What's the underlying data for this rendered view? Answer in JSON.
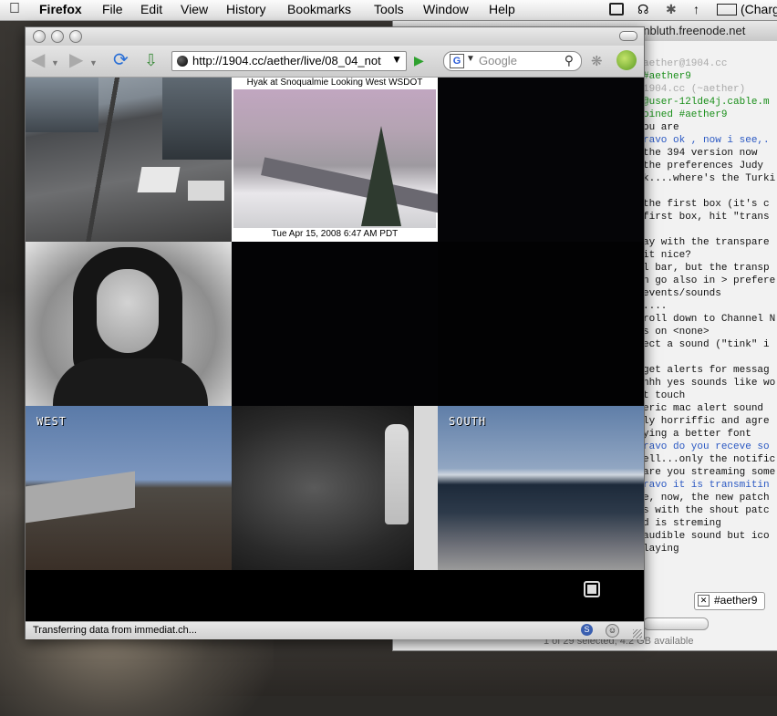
{
  "menubar": {
    "app": "Firefox",
    "items": [
      "File",
      "Edit",
      "View",
      "History",
      "Bookmarks",
      "Tools",
      "Window",
      "Help"
    ],
    "battery_label": "(Charg"
  },
  "irc": {
    "title": "rnbluth.freenode.net",
    "lines": [
      {
        "t": "aether@1904.cc",
        "c": "gray"
      },
      {
        "t": "#aether9",
        "c": "g"
      },
      {
        "t": "1904.cc (~aether)",
        "c": "gray"
      },
      {
        "t": "@user-12lde4j.cable.m",
        "c": "g"
      },
      {
        "t": "oined #aether9",
        "c": "g"
      },
      {
        "t": "ou are",
        "c": ""
      },
      {
        "t": "ravo ok , now i see,.",
        "c": "b"
      },
      {
        "t": "the 394 version now",
        "c": ""
      },
      {
        "t": "the preferences Judy",
        "c": ""
      },
      {
        "t": "k....where's the Turki",
        "c": ""
      },
      {
        "t": "",
        "c": ""
      },
      {
        "t": "the first box (it's c",
        "c": ""
      },
      {
        "t": "first box, hit \"trans",
        "c": ""
      },
      {
        "t": "",
        "c": ""
      },
      {
        "t": "ay with the transpare",
        "c": ""
      },
      {
        "t": "it nice?",
        "c": ""
      },
      {
        "t": "l bar, but the transp",
        "c": ""
      },
      {
        "t": "n go also in > prefere",
        "c": ""
      },
      {
        "t": "events/sounds",
        "c": ""
      },
      {
        "t": "....",
        "c": ""
      },
      {
        "t": "roll down to Channel N",
        "c": ""
      },
      {
        "t": "s on <none>",
        "c": ""
      },
      {
        "t": "ect a sound (\"tink\" i",
        "c": ""
      },
      {
        "t": "",
        "c": ""
      },
      {
        "t": "get alerts for messag",
        "c": ""
      },
      {
        "t": "hhh yes sounds like wo",
        "c": ""
      },
      {
        "t": "t touch",
        "c": ""
      },
      {
        "t": "eric mac alert sound",
        "c": ""
      },
      {
        "t": "ly horriffic and agre",
        "c": ""
      },
      {
        "t": "ying a better font",
        "c": ""
      },
      {
        "t": "ravo do you receve so",
        "c": "b"
      },
      {
        "t": "ell...only the notific",
        "c": ""
      },
      {
        "t": "are you streaming some",
        "c": ""
      },
      {
        "t": "ravo it is transmitin",
        "c": "b"
      },
      {
        "t": "e, now, the new patch",
        "c": ""
      },
      {
        "t": "s with the shout patc",
        "c": ""
      },
      {
        "t": "d is streming",
        "c": ""
      },
      {
        "t": "audible sound but ico",
        "c": ""
      },
      {
        "t": "laying",
        "c": ""
      }
    ],
    "tab_label": "#aether9",
    "status": "1 of 29 selected, 4.2 GB available"
  },
  "browser": {
    "url": "http://1904.cc/aether/live/08_04_not",
    "search_placeholder": "Google",
    "status_text": "Transferring data from immediat.ch..."
  },
  "cams": {
    "snow_caption": "Hyak at Snoqualmie Looking West WSDOT",
    "snow_timestamp": "Tue Apr 15, 2008 6:47 AM PDT",
    "west_label": "WEST",
    "south_label": "SOUTH"
  }
}
